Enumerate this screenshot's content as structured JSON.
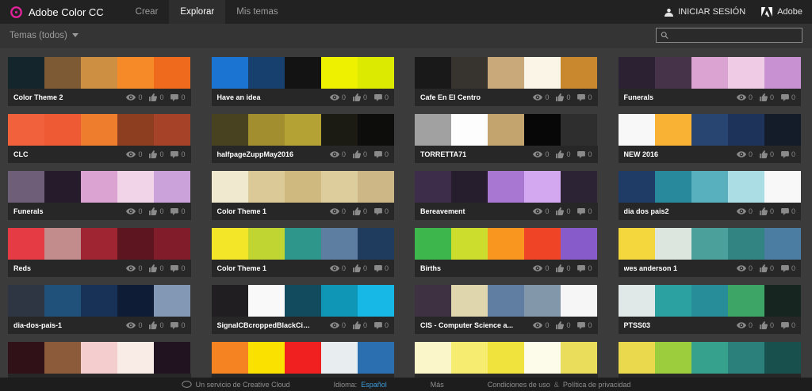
{
  "header": {
    "app_title": "Adobe Color CC",
    "nav": [
      {
        "label": "Crear"
      },
      {
        "label": "Explorar"
      },
      {
        "label": "Mis temas"
      }
    ],
    "sign_in": "INICIAR SESIÓN",
    "adobe": "Adobe"
  },
  "filter_bar": {
    "themes_dropdown": "Temas (todos)",
    "search_placeholder": ""
  },
  "cards": [
    {
      "name": "Color Theme 2",
      "colors": [
        "#14262b",
        "#7d5a33",
        "#cd8f42",
        "#f78a28",
        "#f06a1d"
      ],
      "views": "0",
      "likes": "0",
      "comments": "0"
    },
    {
      "name": "Have an idea",
      "colors": [
        "#1b74d2",
        "#17406e",
        "#131313",
        "#eef200",
        "#dce900"
      ],
      "views": "0",
      "likes": "0",
      "comments": "0"
    },
    {
      "name": "Cafe En El Centro",
      "colors": [
        "#191919",
        "#37332e",
        "#c9a87a",
        "#fbf5e8",
        "#c9882d"
      ],
      "views": "0",
      "likes": "0",
      "comments": "0"
    },
    {
      "name": "Funerals",
      "colors": [
        "#2b2132",
        "#463249",
        "#dba3d1",
        "#efcbe5",
        "#c791d2"
      ],
      "views": "0",
      "likes": "0",
      "comments": "0"
    },
    {
      "name": "CLC",
      "colors": [
        "#f1613c",
        "#ed5a33",
        "#ee7e2e",
        "#8d3d20",
        "#a64228"
      ],
      "views": "0",
      "likes": "0",
      "comments": "0"
    },
    {
      "name": "halfpageZuppMay2016",
      "colors": [
        "#484220",
        "#a28e2e",
        "#b5a234",
        "#1b1b14",
        "#0d0d0b"
      ],
      "views": "0",
      "likes": "0",
      "comments": "0"
    },
    {
      "name": "TORRETTA71",
      "colors": [
        "#a1a1a1",
        "#fdfdfd",
        "#c3a46f",
        "#070707",
        "#2e2e2e"
      ],
      "views": "0",
      "likes": "0",
      "comments": "0"
    },
    {
      "name": "NEW 2016",
      "colors": [
        "#f8f8f8",
        "#f9b233",
        "#274570",
        "#1e3359",
        "#141b29"
      ],
      "views": "0",
      "likes": "0",
      "comments": "0"
    },
    {
      "name": "Funerals",
      "colors": [
        "#6f5e77",
        "#261b2a",
        "#dba3d1",
        "#f2d4e9",
        "#cba2da"
      ],
      "views": "0",
      "likes": "0",
      "comments": "0"
    },
    {
      "name": "Color Theme 1",
      "colors": [
        "#f0e9d0",
        "#dbc997",
        "#cfb97e",
        "#ddcc9c",
        "#cdb786"
      ],
      "views": "0",
      "likes": "0",
      "comments": "0"
    },
    {
      "name": "Bereavement",
      "colors": [
        "#3e2c4b",
        "#261d2d",
        "#a877d2",
        "#d4a8f1",
        "#2c2335"
      ],
      "views": "0",
      "likes": "0",
      "comments": "0"
    },
    {
      "name": "dia dos pais2",
      "colors": [
        "#1f3c67",
        "#28899d",
        "#58b0be",
        "#abdee4",
        "#f8f8f8"
      ],
      "views": "0",
      "likes": "0",
      "comments": "0"
    },
    {
      "name": "Reds",
      "colors": [
        "#e53b45",
        "#c38c8c",
        "#9e2531",
        "#5d1520",
        "#811d2a"
      ],
      "views": "0",
      "likes": "0",
      "comments": "0"
    },
    {
      "name": "Color Theme 1",
      "colors": [
        "#f3e528",
        "#c0d531",
        "#2f968b",
        "#5d7ea0",
        "#1f3b5e"
      ],
      "views": "0",
      "likes": "0",
      "comments": "0"
    },
    {
      "name": "Births",
      "colors": [
        "#3db64c",
        "#cddd2e",
        "#f89620",
        "#ef4425",
        "#885bca"
      ],
      "views": "0",
      "likes": "0",
      "comments": "0"
    },
    {
      "name": "wes anderson 1",
      "colors": [
        "#f3d73c",
        "#dce5de",
        "#4ba09c",
        "#318482",
        "#4b7ca2"
      ],
      "views": "0",
      "likes": "0",
      "comments": "0"
    },
    {
      "name": "dia-dos-pais-1",
      "colors": [
        "#2d3642",
        "#1f517a",
        "#183157",
        "#0e1d35",
        "#8298b4"
      ],
      "views": "0",
      "likes": "0",
      "comments": "0"
    },
    {
      "name": "SignalCBcroppedBlackCir...",
      "colors": [
        "#201e20",
        "#f9f9f9",
        "#134b5e",
        "#0f96b6",
        "#18b8e6"
      ],
      "views": "0",
      "likes": "0",
      "comments": "0"
    },
    {
      "name": "CIS - Computer Science a...",
      "colors": [
        "#3e3242",
        "#e0d6ad",
        "#5f7ea2",
        "#8298aa",
        "#f6f6f6"
      ],
      "views": "0",
      "likes": "0",
      "comments": "0"
    },
    {
      "name": "PTSS03",
      "colors": [
        "#e1e9e8",
        "#2ba1a2",
        "#278d98",
        "#3da666",
        "#172521"
      ],
      "views": "0",
      "likes": "0",
      "comments": "0"
    },
    {
      "name": "",
      "colors": [
        "#301118",
        "#8c5c3a",
        "#f4cdcf",
        "#f9ebe6",
        "#211320"
      ],
      "views": "",
      "likes": "",
      "comments": ""
    },
    {
      "name": "",
      "colors": [
        "#f68322",
        "#fbe100",
        "#f02020",
        "#e8eef0",
        "#2b6fb1"
      ],
      "views": "",
      "likes": "",
      "comments": ""
    },
    {
      "name": "",
      "colors": [
        "#faf6c9",
        "#f6ec70",
        "#f1e33e",
        "#fdfbe9",
        "#e9dd5b"
      ],
      "views": "",
      "likes": "",
      "comments": ""
    },
    {
      "name": "",
      "colors": [
        "#ead94c",
        "#9bcd3d",
        "#36a18c",
        "#2b807b",
        "#18504d"
      ],
      "views": "",
      "likes": "",
      "comments": ""
    }
  ],
  "footer": {
    "service": "Un servicio de Creative Cloud",
    "language_label": "Idioma:",
    "language_value": "Español",
    "more": "Más",
    "terms": "Condiciones de uso",
    "amp": "&",
    "privacy": "Política de privacidad"
  },
  "colors": {
    "brand_magenta": "#e5239d",
    "accent_blue": "#3b9ad9"
  }
}
